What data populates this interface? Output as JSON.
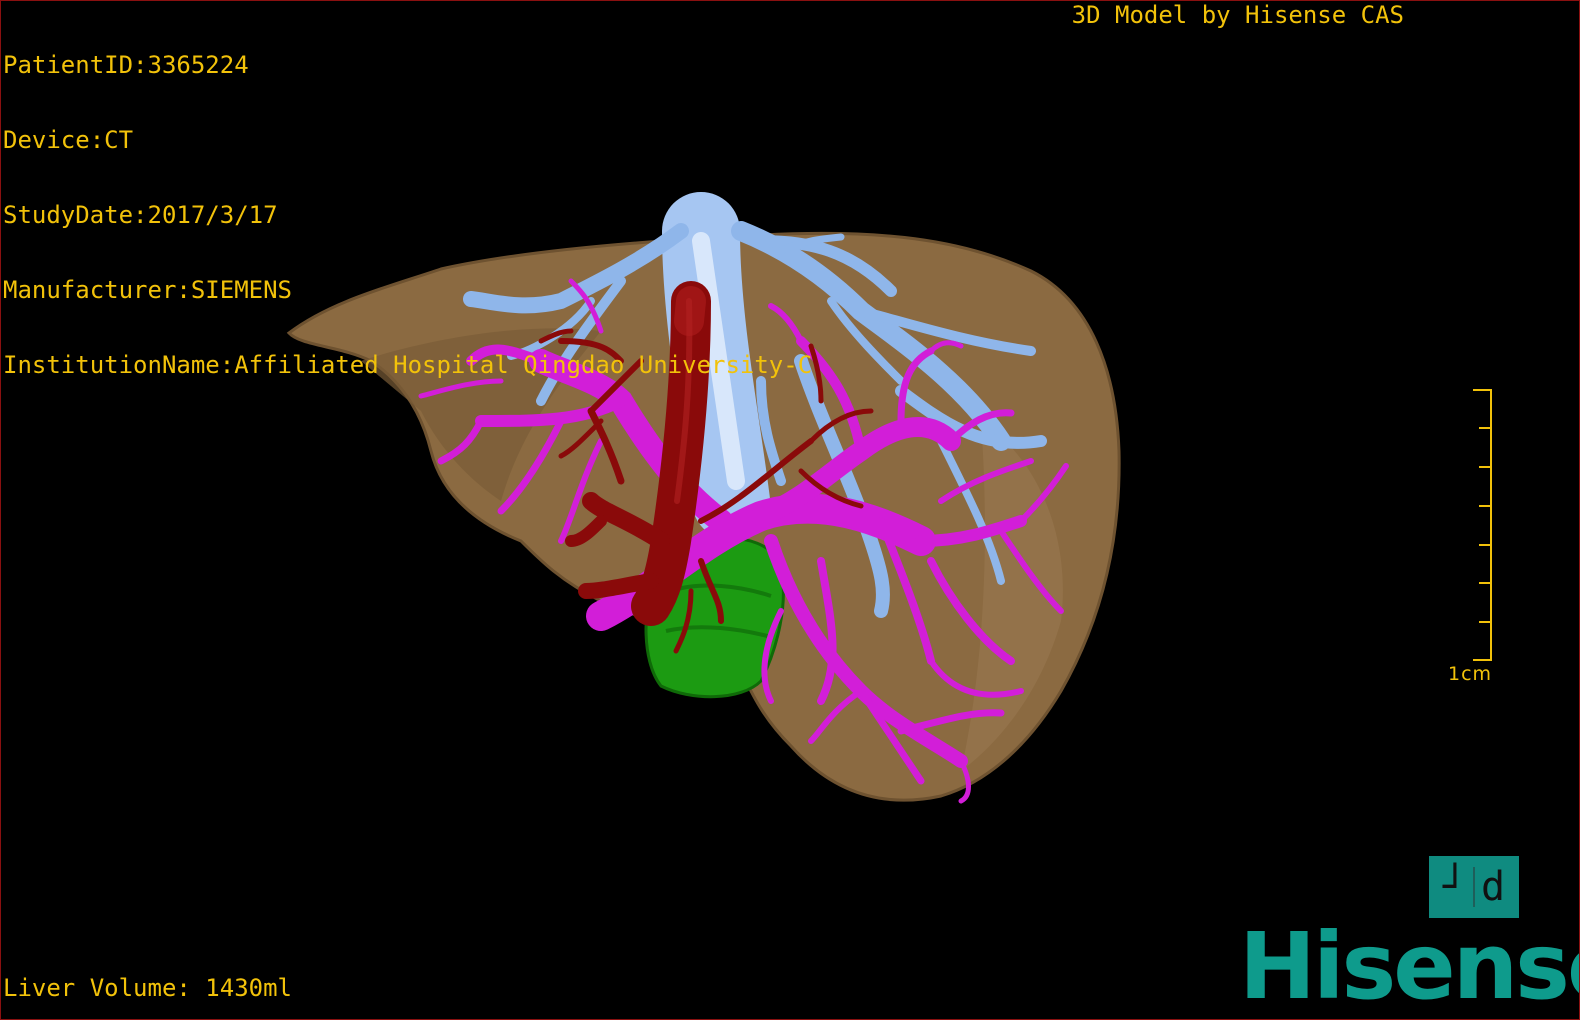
{
  "patient_info": {
    "patient_id": "PatientID:3365224",
    "device": "Device:CT",
    "study_date": "StudyDate:2017/3/17",
    "manufacturer": "Manufacturer:SIEMENS",
    "institution": "InstitutionName:Affiliated Hospital Qingdao University-C"
  },
  "header_right": "3D Model by Hisense CAS",
  "liver_volume": "Liver Volume: 1430ml",
  "scale": {
    "label": "1cm"
  },
  "orientation_cube": {
    "left_glyph": "┘",
    "right_glyph": "d"
  },
  "logo": "Hisense",
  "colors": {
    "overlay_text": "#f2c20a",
    "liver": "#8c6a40",
    "hepatic_vein": "#8fb6ea",
    "portal_vein": "#d21ed8",
    "artery": "#8a0a0a",
    "gallbladder": "#1b9a12",
    "brand": "#0e9b8c"
  },
  "model_structures": [
    "liver-parenchyma",
    "hepatic-vein",
    "portal-vein",
    "hepatic-artery",
    "gallbladder"
  ]
}
